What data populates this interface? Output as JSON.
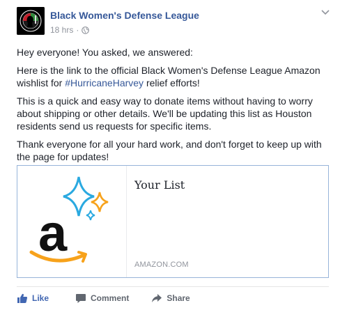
{
  "post": {
    "page_name": "Black Women's Defense League",
    "timestamp": "18 hrs",
    "separator": "·",
    "paragraphs": {
      "p1": "Hey everyone! You asked, we answered:",
      "p2_before": "Here is the link to the official Black Women's Defense League Amazon wishlist for ",
      "p2_hashtag": "#HurricaneHarvey",
      "p2_after": " relief efforts!",
      "p3": "This is a quick and easy way to donate items without having to worry about shipping or other details. We'll be updating this list as Houston residents send us requests for specific items.",
      "p4": "Thank everyone for all your hard work, and don't forget to keep up with the page for updates!"
    },
    "link_card": {
      "title": "Your List",
      "domain": "AMAZON.COM"
    }
  },
  "actions": {
    "like": "Like",
    "comment": "Comment",
    "share": "Share"
  },
  "colors": {
    "link": "#365899",
    "like": "#4267b2",
    "muted": "#90949c",
    "card_border": "#97b4d9"
  },
  "icons": [
    "page-avatar-logo",
    "globe-icon",
    "chevron-down-icon",
    "amazon-logo-icon",
    "thumbs-up-icon",
    "comment-icon",
    "share-arrow-icon"
  ]
}
